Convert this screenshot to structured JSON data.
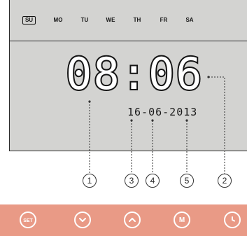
{
  "weekdays": [
    "SU",
    "MO",
    "TU",
    "WE",
    "TH",
    "FR",
    "SA"
  ],
  "active_day": "SU",
  "time_display": "08:06",
  "date_display": "16-06-2013",
  "callouts": [
    "1",
    "3",
    "4",
    "5",
    "2"
  ],
  "buttons": {
    "set_label": "SET",
    "down_icon": "chevron-down-icon",
    "up_icon": "chevron-up-icon",
    "mode_label": "M",
    "clock_icon": "clock-icon"
  },
  "colors": {
    "lcd_background": "#d3d3d1",
    "button_bar": "#e99a86",
    "segment": "#141414"
  }
}
